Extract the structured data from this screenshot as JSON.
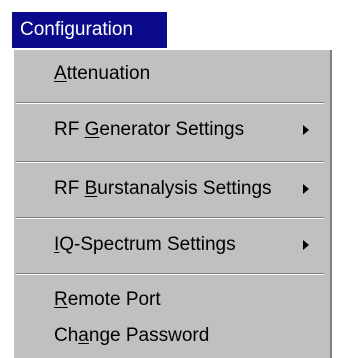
{
  "menu": {
    "title": "Configuration",
    "items": [
      {
        "pre": "",
        "mn": "A",
        "post": "ttenuation",
        "submenu": false
      },
      {
        "pre": "RF ",
        "mn": "G",
        "post": "enerator Settings",
        "submenu": true
      },
      {
        "pre": "RF ",
        "mn": "B",
        "post": "urstanalysis Settings",
        "submenu": true
      },
      {
        "pre": "",
        "mn": "I",
        "post": "Q-Spectrum Settings",
        "submenu": true
      },
      {
        "pre": "",
        "mn": "R",
        "post": "emote Port",
        "submenu": false
      },
      {
        "pre": "Ch",
        "mn": "a",
        "post": "nge Password",
        "submenu": false
      }
    ]
  },
  "colors": {
    "title_bg": "#0a0a8a",
    "menu_bg": "#c0c0c0"
  }
}
